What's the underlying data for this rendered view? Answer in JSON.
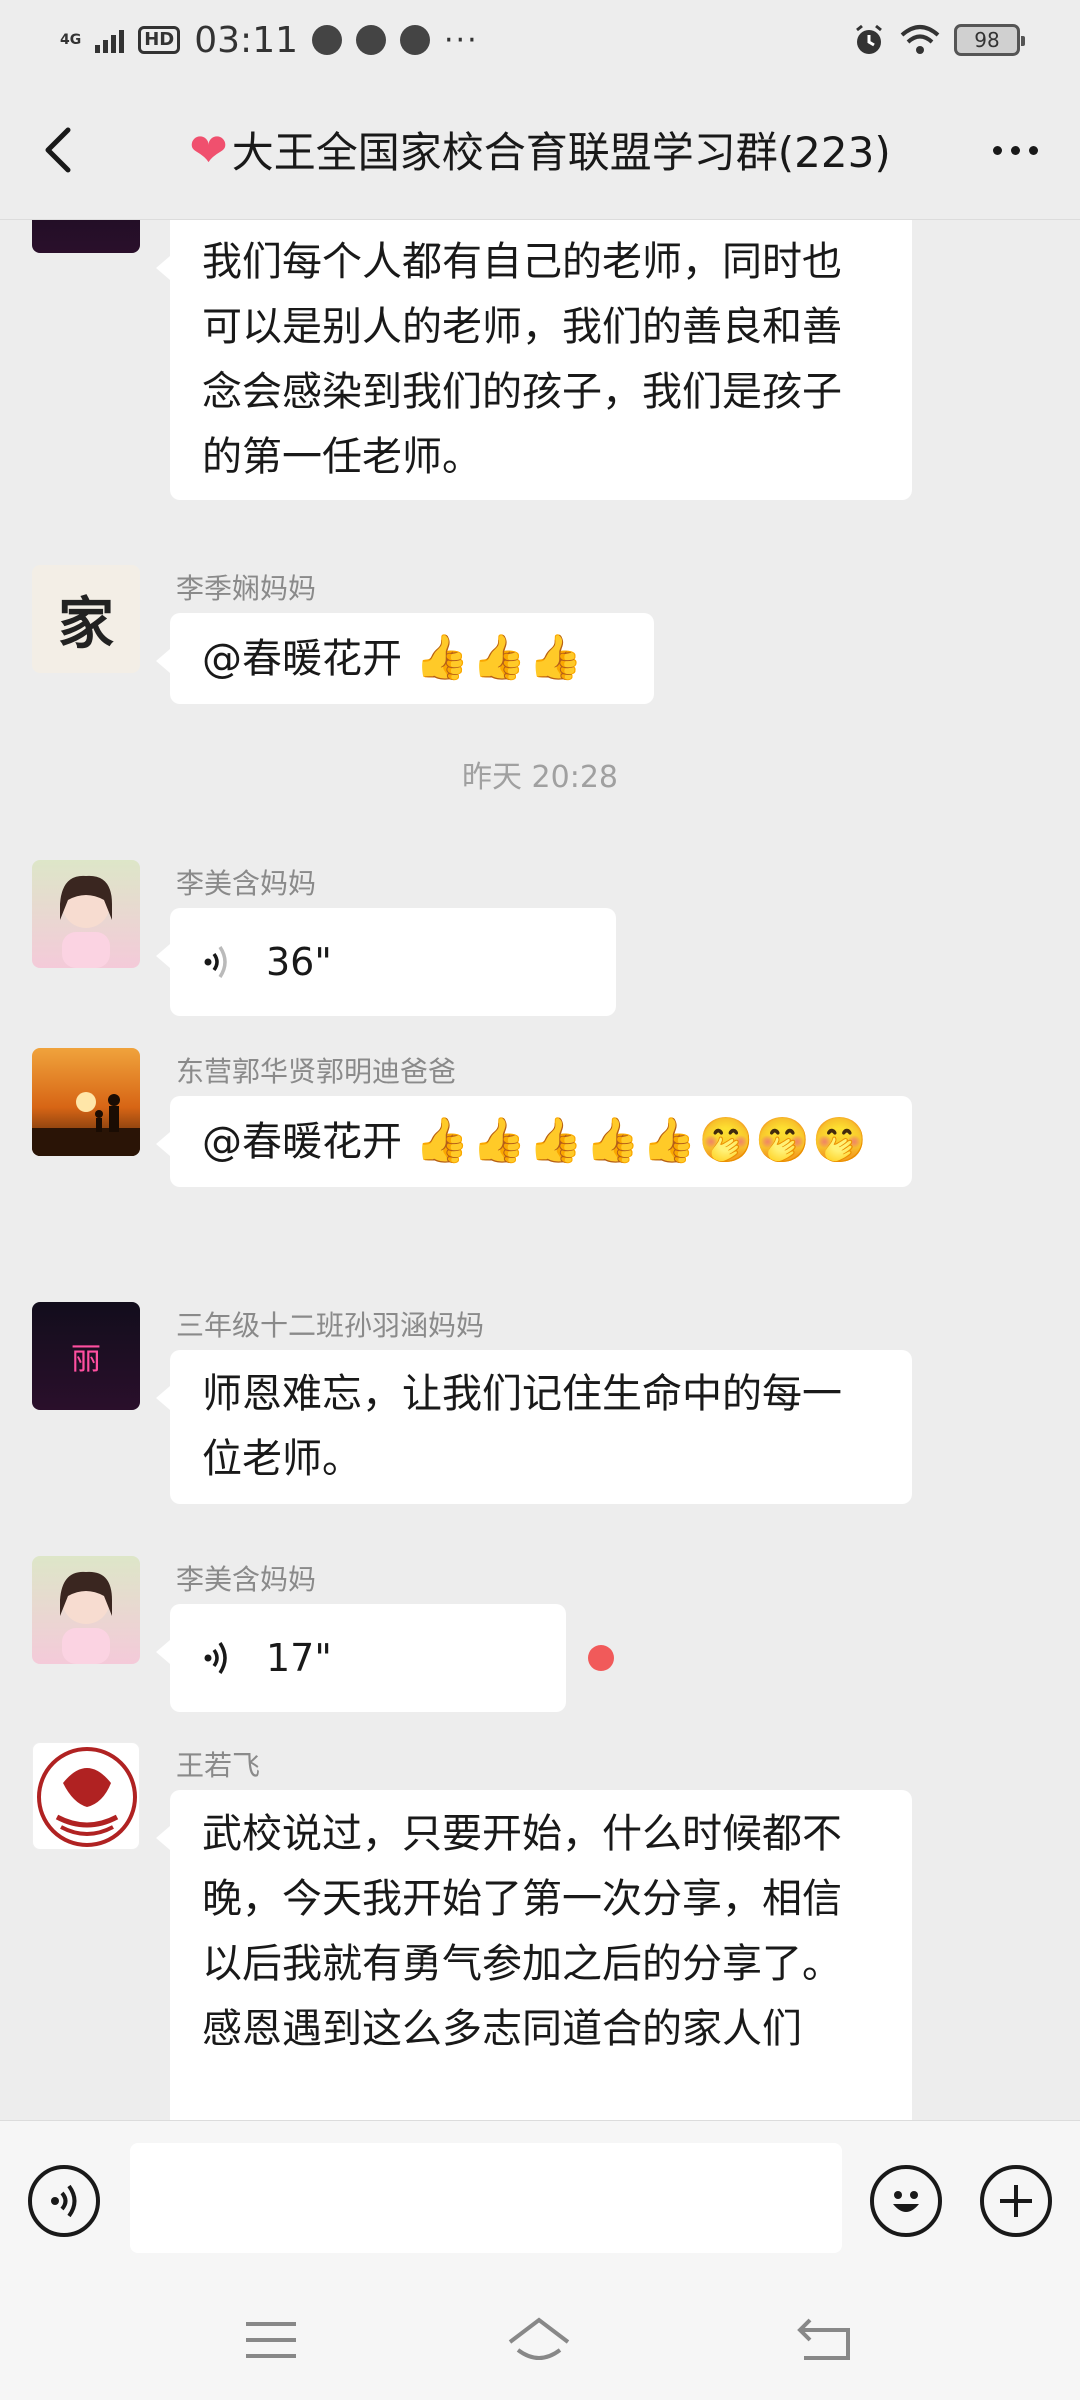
{
  "status_bar": {
    "network": "4G",
    "hd": "HD",
    "time": "03:11",
    "more": "···",
    "battery": "98"
  },
  "header": {
    "title": "大王全国家校合育联盟学习群(223)",
    "heart_icon": "heart-emoji"
  },
  "messages": [
    {
      "id": "m1",
      "sender": "",
      "text": "我们每个人都有自己的老师，同时也可以是别人的老师，我们的善良和善念会感染到我们的孩子，我们是孩子的第一任老师。"
    },
    {
      "id": "m2",
      "sender": "李季娴妈妈",
      "text": "@春暖花开 ",
      "emoji": "👍👍👍"
    },
    {
      "id": "sep",
      "time": "昨天 20:28"
    },
    {
      "id": "m3",
      "sender": "李美含妈妈",
      "voice_duration": "36\""
    },
    {
      "id": "m4",
      "sender": "东营郭华贤郭明迪爸爸",
      "text": "@春暖花开 ",
      "emoji": "👍👍👍👍👍🤭🤭🤭"
    },
    {
      "id": "m5",
      "sender": "三年级十二班孙羽涵妈妈",
      "text": "师恩难忘，让我们记住生命中的每一位老师。",
      "avatar_text": "丽"
    },
    {
      "id": "m6",
      "sender": "李美含妈妈",
      "voice_duration": "17\"",
      "unread": true
    },
    {
      "id": "m7",
      "sender": "王若飞",
      "text": "武校说过，只要开始，什么时候都不晚，今天我开始了第一次分享，相信以后我就有勇气参加之后的分享了。感恩遇到这么多志同道合的家人们"
    }
  ],
  "avatars": {
    "home_char": "家"
  },
  "input_bar": {
    "placeholder": ""
  },
  "colors": {
    "background": "#ededed",
    "bubble": "#ffffff",
    "unread": "#f15a5a",
    "sender_text": "#8a8a8a"
  }
}
